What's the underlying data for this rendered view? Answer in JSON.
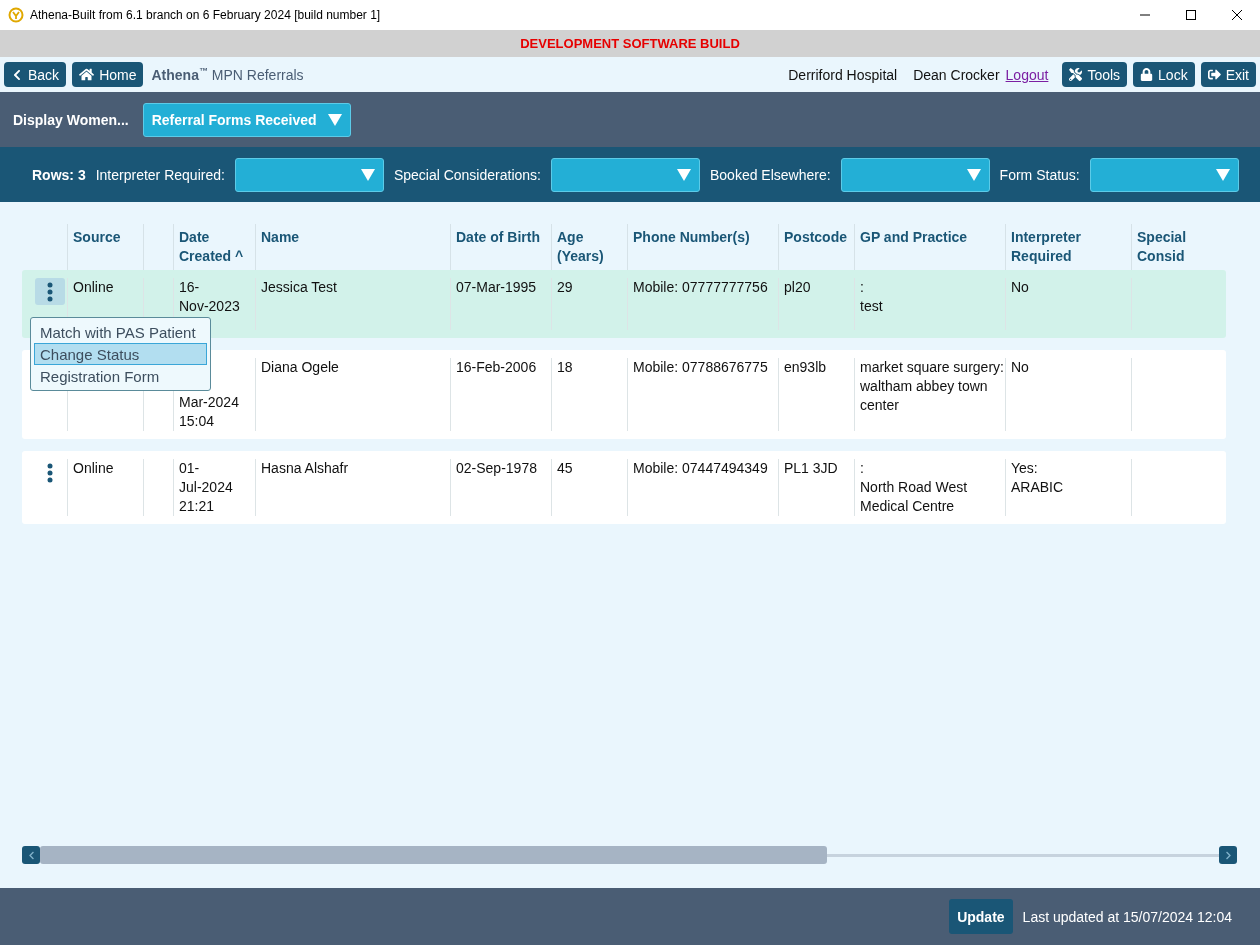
{
  "window": {
    "title": "Athena-Built from 6.1 branch on 6 February 2024 [build number 1]"
  },
  "banner": "DEVELOPMENT SOFTWARE BUILD",
  "nav": {
    "back": "Back",
    "home": "Home",
    "brand": "Athena",
    "brand_mark": "™",
    "module": "MPN Referrals",
    "hospital": "Derriford Hospital",
    "user": "Dean Crocker",
    "logout": "Logout",
    "tools": "Tools",
    "lock": "Lock",
    "exit": "Exit"
  },
  "display": {
    "label": "Display Women...",
    "value": "Referral Forms Received"
  },
  "filters": {
    "rows": "Rows: 3",
    "items": [
      {
        "label": "Interpreter Required:"
      },
      {
        "label": "Special Considerations:"
      },
      {
        "label": "Booked Elsewhere:"
      },
      {
        "label": "Form Status:"
      }
    ]
  },
  "table": {
    "columns": [
      "",
      "Source",
      "",
      "Date Created ^",
      "Name",
      "Date of Birth",
      "Age (Years)",
      "Phone Number(s)",
      "Postcode",
      "GP and Practice",
      "Interpreter Required",
      "Special Consid"
    ],
    "rows": [
      {
        "selected": true,
        "menu_open": true,
        "source": "Online",
        "date": [
          "16-",
          "Nov-2023"
        ],
        "name": "Jessica Test",
        "dob": "07-Mar-1995",
        "age": "29",
        "phone": "Mobile: 07777777756",
        "postcode": "pl20",
        "gp": [
          ":",
          "test"
        ],
        "interpreter": [
          "No"
        ]
      },
      {
        "selected": false,
        "date": [
          "Mar-2024",
          "15:04"
        ],
        "name": "Diana Ogele",
        "dob": "16-Feb-2006",
        "age": "18",
        "phone": "Mobile: 07788676775",
        "postcode": "en93lb",
        "gp": [
          "market square surgery:",
          "waltham abbey town",
          "center"
        ],
        "interpreter": [
          "No"
        ]
      },
      {
        "selected": false,
        "menu_open": false,
        "source": "Online",
        "date": [
          "01-",
          "Jul-2024",
          "21:21"
        ],
        "name": "Hasna Alshafr",
        "dob": "02-Sep-1978",
        "age": "45",
        "phone": "Mobile: 07447494349",
        "postcode": "PL1 3JD",
        "gp": [
          ":",
          "North Road West",
          "Medical Centre"
        ],
        "interpreter": [
          "Yes:",
          "ARABIC"
        ]
      }
    ]
  },
  "menu": {
    "items": [
      {
        "label": "Match with PAS Patient",
        "selected": false
      },
      {
        "label": "Change Status",
        "selected": true
      },
      {
        "label": "Registration Form",
        "selected": false
      }
    ]
  },
  "footer": {
    "update": "Update",
    "last_updated": "Last updated at 15/07/2024 12:04"
  }
}
